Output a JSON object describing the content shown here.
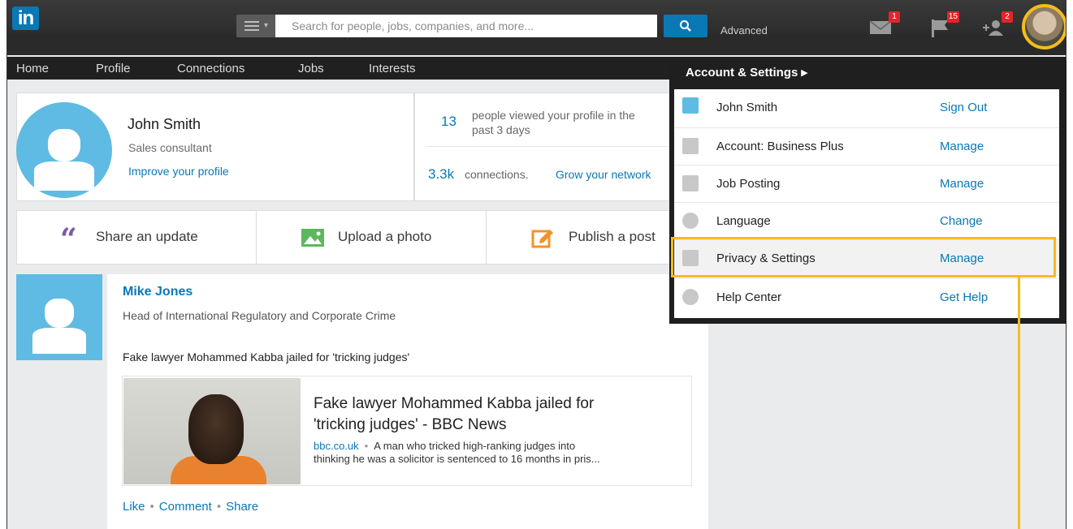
{
  "header": {
    "logo": "in",
    "search_placeholder": "Search for people, jobs, companies, and more...",
    "advanced": "Advanced",
    "badges": {
      "messages": "1",
      "notifications": "15",
      "invitations": "2"
    }
  },
  "nav": [
    "Home",
    "Profile",
    "Connections",
    "Jobs",
    "Interests"
  ],
  "profile": {
    "name": "John Smith",
    "title": "Sales consultant",
    "improve": "Improve your profile",
    "views_count": "13",
    "views_text_1": "people viewed your profile in the",
    "views_text_2": "past 3 days",
    "connections_count": "3.3k",
    "connections_text": "connections.",
    "grow_link": "Grow your network"
  },
  "share": {
    "update": "Share an update",
    "photo": "Upload a photo",
    "post": "Publish a post"
  },
  "post": {
    "author": "Mike Jones",
    "author_title": "Head of International Regulatory and Corporate Crime",
    "text": "Fake lawyer Mohammed Kabba jailed for 'tricking judges'",
    "link_title_1": "Fake lawyer Mohammed Kabba jailed for",
    "link_title_2": "'tricking judges' - BBC News",
    "link_domain": "bbc.co.uk",
    "link_desc_1": "A man who tricked high-ranking judges into",
    "link_desc_2": "thinking he was a solicitor is sentenced to 16 months in pris...",
    "actions": {
      "like": "Like",
      "comment": "Comment",
      "share": "Share"
    }
  },
  "dropdown": {
    "header": "Account & Settings ▸",
    "rows": [
      {
        "label": "John Smith",
        "action": "Sign Out"
      },
      {
        "label": "Account: Business Plus",
        "action": "Manage"
      },
      {
        "label": "Job Posting",
        "action": "Manage"
      },
      {
        "label": "Language",
        "action": "Change"
      },
      {
        "label": "Privacy & Settings",
        "action": "Manage"
      },
      {
        "label": "Help Center",
        "action": "Get Help"
      }
    ]
  },
  "colors": {
    "accent": "#0a78b5",
    "highlight": "#f5bc1d",
    "badge": "#e2252a",
    "avatar_bg": "#5fbbe3"
  }
}
